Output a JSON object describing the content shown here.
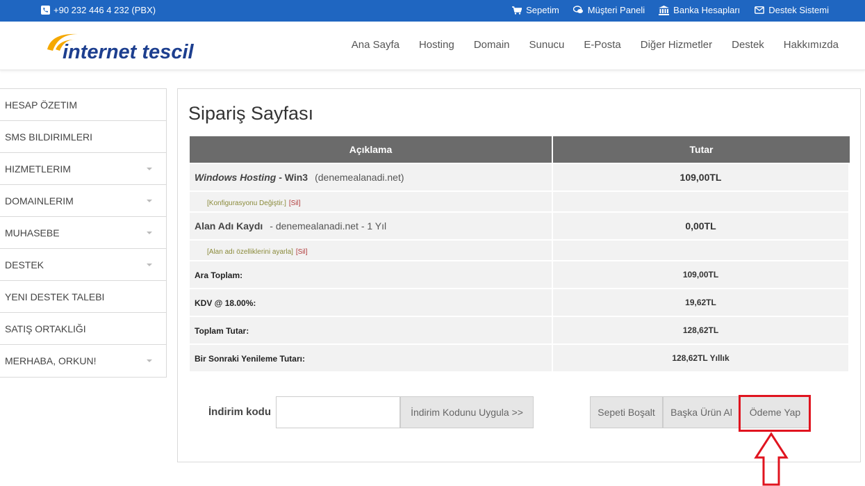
{
  "topbar": {
    "phone": "+90 232 446 4 232 (PBX)",
    "links": [
      {
        "label": "Sepetim",
        "icon": "cart-icon"
      },
      {
        "label": "Müşteri Paneli",
        "icon": "chat-icon"
      },
      {
        "label": "Banka Hesapları",
        "icon": "bank-icon"
      },
      {
        "label": "Destek Sistemi",
        "icon": "envelope-icon"
      }
    ]
  },
  "header": {
    "logo_text": "internet tescil",
    "nav": [
      "Ana Sayfa",
      "Hosting",
      "Domain",
      "Sunucu",
      "E-Posta",
      "Diğer Hizmetler",
      "Destek",
      "Hakkımızda"
    ]
  },
  "sidebar": {
    "items": [
      {
        "label": "HESAP ÖZETIM"
      },
      {
        "label": "SMS BILDIRIMLERI"
      },
      {
        "label": "HIZMETLERIM"
      },
      {
        "label": "DOMAINLERIM"
      },
      {
        "label": "MUHASEBE"
      },
      {
        "label": "DESTEK"
      },
      {
        "label": "YENI DESTEK TALEBI"
      },
      {
        "label": "SATIŞ ORTAKLIĞI"
      },
      {
        "label": "MERHABA, ORKUN!"
      }
    ]
  },
  "main": {
    "title": "Sipariş Sayfası",
    "table": {
      "headers": [
        "Açıklama",
        "Tutar"
      ],
      "items": [
        {
          "name": "Windows Hosting",
          "extra": " - Win3",
          "domain": "(denemealanadi.net)",
          "amount": "109,00TL",
          "sub_link": "[Konfigurasyonu Değiştir.]",
          "sub_del": "[Sil]"
        },
        {
          "name": "Alan Adı Kaydı",
          "domain": "- denemealanadi.net - 1 Yıl",
          "amount": "0,00TL",
          "sub_link": "[Alan adı özelliklerini ayarla]",
          "sub_del": "[Sil]"
        }
      ],
      "subtotal_label": "Ara Toplam:",
      "subtotal": "109,00TL",
      "tax_label": "KDV @ 18.00%:",
      "tax": "19,62TL",
      "total_label": "Toplam Tutar:",
      "total": "128,62TL",
      "renew_label": "Bir Sonraki Yenileme Tutarı:",
      "renew": "128,62TL Yıllık"
    },
    "discount": {
      "label": "İndirim kodu",
      "value": "",
      "apply_label": "İndirim Kodunu Uygula >>"
    },
    "buttons": {
      "empty": "Sepeti Boşalt",
      "more": "Başka Ürün Al",
      "pay": "Ödeme Yap"
    }
  },
  "colors": {
    "topbar": "#1f66c1",
    "table_header": "#6b6b6b",
    "total_row": "#ecfae0",
    "renew_row": "#fbdcdc",
    "highlight": "#e0141f"
  }
}
